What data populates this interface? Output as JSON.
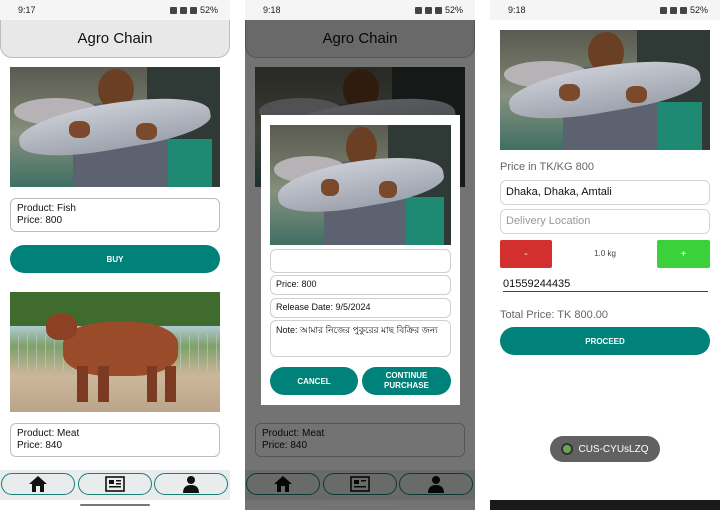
{
  "status": {
    "screen1_time": "9:17",
    "screen2_time": "9:18",
    "screen3_time": "9:18",
    "battery": "52%"
  },
  "app": {
    "title": "Agro Chain"
  },
  "products": [
    {
      "label": "Product: Fish",
      "price": "Price: 800",
      "image": "fish-photo"
    },
    {
      "label": "Product: Meat",
      "price": "Price: 840",
      "image": "cow-photo"
    }
  ],
  "buy_label": "BUY",
  "nav": {
    "items": [
      "home-icon",
      "news-icon",
      "person-icon"
    ]
  },
  "dialog": {
    "name_value": "",
    "price": "Price: 800",
    "release_date": "Release Date: 9/5/2024",
    "note": "Note: আমার নিজের পুকুরের মাছ বিক্রির জন্য",
    "cancel_label": "CANCEL",
    "continue_label": "CONTINUE PURCHASE"
  },
  "purchase": {
    "price_per_kg": "Price in TK/KG 800",
    "address_value": "Dhaka, Dhaka, Amtali",
    "delivery_placeholder": "Delivery Location",
    "minus_label": "-",
    "quantity": "1.0 kg",
    "plus_label": "+",
    "phone_value": "01559244435",
    "total_price": "Total Price: TK 800.00",
    "proceed_label": "PROCEED",
    "toast": "CUS-CYUsLZQ"
  },
  "colors": {
    "accent": "#00827a",
    "minus": "#d32f2f",
    "plus": "#3ad13a"
  }
}
